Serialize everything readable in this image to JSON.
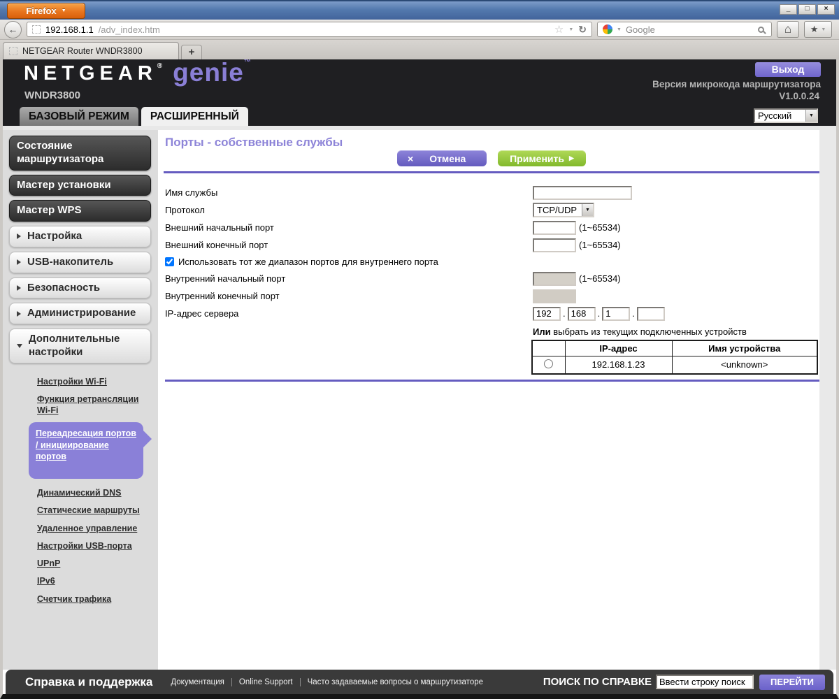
{
  "browser": {
    "menu_button": "Firefox",
    "url_host": "192.168.1.1",
    "url_path": "/adv_index.htm",
    "search_engine": "Google",
    "tab_title": "NETGEAR Router WNDR3800",
    "new_tab_label": "+",
    "window_controls": {
      "minimize": "_",
      "maximize": "□",
      "close": "×"
    },
    "icons": {
      "dropdown": "▼",
      "back_arrow": "←",
      "star_outline": "☆",
      "reload": "↻",
      "home": "⌂",
      "bookmark_star": "★"
    }
  },
  "header": {
    "brand": "NETGEAR",
    "brand_reg": "®",
    "product": "genie",
    "product_tm": "™",
    "model": "WNDR3800",
    "logout_button": "Выход",
    "firmware_label": "Версия микрокода маршрутизатора",
    "firmware_version": "V1.0.0.24",
    "mode_tabs": {
      "basic": "БАЗОВЫЙ РЕЖИМ",
      "advanced": "РАСШИРЕННЫЙ"
    },
    "language_select": "Русский"
  },
  "sidebar": {
    "dark_items": [
      {
        "label": "Состояние маршрутизатора"
      },
      {
        "label": "Мастер установки"
      },
      {
        "label": "Мастер WPS"
      }
    ],
    "expand_items": [
      {
        "label": "Настройка"
      },
      {
        "label": "USB-накопитель"
      },
      {
        "label": "Безопасность"
      },
      {
        "label": "Администрирование"
      },
      {
        "label": "Дополнительные настройки"
      }
    ],
    "sub_items": [
      {
        "label": "Настройки Wi-Fi"
      },
      {
        "label": "Функция ретрансляции Wi-Fi"
      },
      {
        "label": "Переадресация портов / инициирование портов",
        "selected": true
      },
      {
        "label": "Динамический DNS"
      },
      {
        "label": "Статические маршруты"
      },
      {
        "label": "Удаленное управление"
      },
      {
        "label": "Настройки USB-порта"
      },
      {
        "label": "UPnP"
      },
      {
        "label": "IPv6"
      },
      {
        "label": "Счетчик трафика"
      }
    ]
  },
  "main": {
    "title": "Порты - собственные службы",
    "cancel_button": "Отмена",
    "cancel_icon": "×",
    "apply_button": "Применить",
    "apply_icon": "▶",
    "fields": {
      "service_name_label": "Имя службы",
      "service_name_value": "",
      "protocol_label": "Протокол",
      "protocol_value": "TCP/UDP",
      "ext_start_label": "Внешний начальный порт",
      "ext_start_value": "",
      "ext_start_hint": "(1~65534)",
      "ext_end_label": "Внешний конечный порт",
      "ext_end_value": "",
      "ext_end_hint": "(1~65534)",
      "same_range_label": "Использовать тот же диапазон портов для внутреннего порта",
      "same_range_checked": true,
      "int_start_label": "Внутренний начальный порт",
      "int_start_value": "",
      "int_start_hint": "(1~65534)",
      "int_end_label": "Внутренний конечный порт",
      "server_ip_label": "IP-адрес сервера",
      "ip_octets": [
        "192",
        "168",
        "1",
        ""
      ],
      "ip_separator": "."
    },
    "or_line": {
      "bold": "Или",
      "rest": " выбрать из текущих подключенных устройств"
    },
    "device_table": {
      "headers": [
        "",
        "IP-адрес",
        "Имя устройства"
      ],
      "rows": [
        {
          "ip": "192.168.1.23",
          "name": "<unknown>"
        }
      ]
    }
  },
  "footer": {
    "help_title": "Справка и поддержка",
    "links": [
      "Документация",
      "Online Support",
      "Часто задаваемые вопросы о маршрутизаторе"
    ],
    "search_label": "ПОИСК ПО СПРАВКЕ",
    "search_value": "Ввести строку поиск",
    "go_button": "ПЕРЕЙТИ"
  },
  "colors": {
    "accent_purple": "#7d73d5",
    "brand_purple": "#8a7fd6",
    "apply_green": "#8dc63f",
    "header_bg": "#1f1f22",
    "footer_bg": "#3a3a3a",
    "sidebar_bg": "#dcdcdc",
    "disabled_input": "#d4d0c8"
  }
}
